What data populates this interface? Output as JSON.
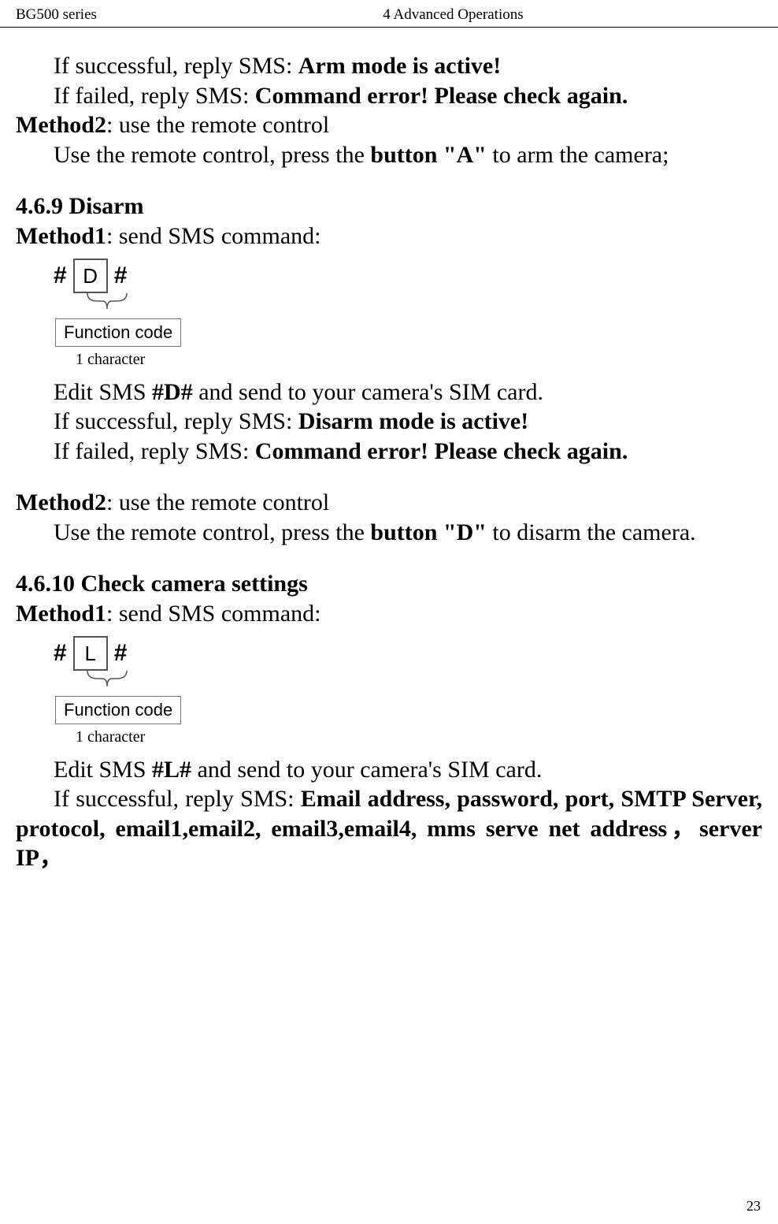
{
  "header": {
    "left": "BG500 series",
    "center": "4 Advanced Operations"
  },
  "text": {
    "success_prefix": "If successful, reply SMS: ",
    "arm_success": "Arm mode is active!",
    "fail_prefix": "If failed, reply SMS: ",
    "fail_msg": "Command error! Please check again.",
    "method2_label": "Method2",
    "method2_rest": ": use the remote control",
    "arm_remote_pre": "Use the remote control, press the ",
    "arm_button": "button \"A\"",
    "arm_remote_post": " to arm the camera;",
    "section_469": "4.6.9 Disarm",
    "method1_label": "Method1",
    "method1_rest": ": send SMS command:",
    "edit_sms_pre": "Edit SMS ",
    "code_d": "#D#",
    "edit_sms_post": " and send to your camera's SIM card.",
    "disarm_success": "Disarm mode is active!",
    "disarm_remote_pre": "Use the remote control, press the ",
    "disarm_button": "button \"D\"",
    "disarm_remote_post": " to disarm the camera.",
    "section_4610": "4.6.10   Check camera settings",
    "code_l": "#L#",
    "settings_reply": "Email address, password, port,  SMTP Server, protocol, email1,email2, email3,email4, mms serve net address，server IP，"
  },
  "diagram": {
    "letter_d": "D",
    "letter_l": "L",
    "hash": "#",
    "func_code": "Function code",
    "char_count": "1 character"
  },
  "page_number": "23"
}
